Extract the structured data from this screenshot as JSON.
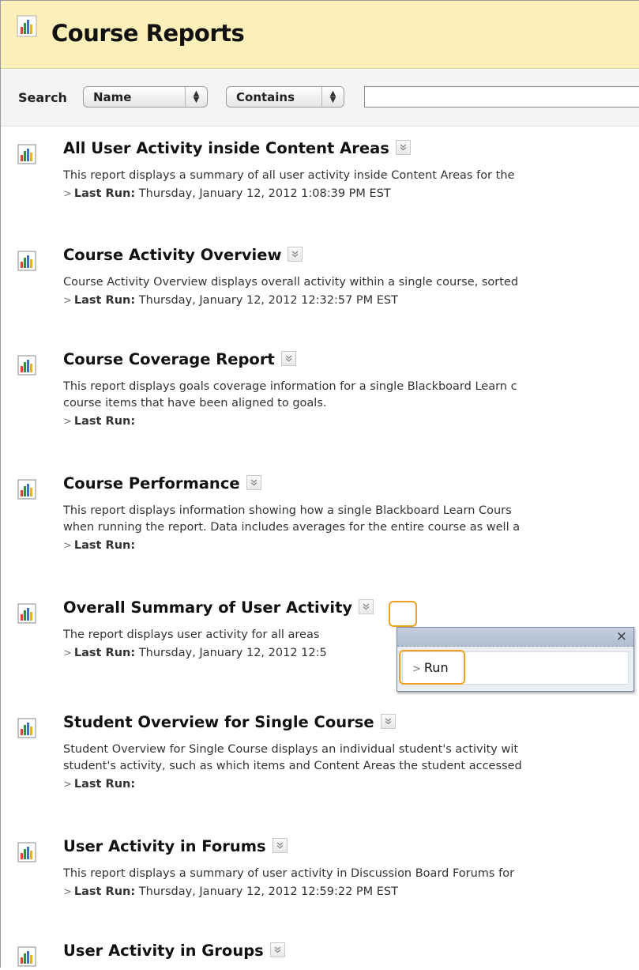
{
  "page": {
    "title": "Course Reports",
    "header_icon": "report-chart-icon",
    "header_bg": "#fcefba"
  },
  "search": {
    "label": "Search",
    "field_select": "Name",
    "operator_select": "Contains",
    "input_value": ""
  },
  "reports": [
    {
      "title": "All User Activity inside Content Areas",
      "desc": [
        "This report displays a summary of all user activity inside Content Areas for the"
      ],
      "last_run_label": "Last Run:",
      "last_run_value": "Thursday, January 12, 2012 1:08:39 PM EST"
    },
    {
      "title": "Course Activity Overview",
      "desc": [
        "Course Activity Overview displays overall activity within a single course, sorted"
      ],
      "last_run_label": "Last Run:",
      "last_run_value": "Thursday, January 12, 2012 12:32:57 PM EST"
    },
    {
      "title": "Course Coverage Report",
      "desc": [
        "This report displays goals coverage information for a single Blackboard Learn c",
        "course items that have been aligned to goals."
      ],
      "last_run_label": "Last Run:",
      "last_run_value": ""
    },
    {
      "title": "Course Performance",
      "desc": [
        "This report displays information showing how a single Blackboard Learn Cours",
        "when running the report. Data includes averages for the entire course as well a"
      ],
      "last_run_label": "Last Run:",
      "last_run_value": ""
    },
    {
      "title": "Overall Summary of User Activity",
      "desc": [
        "The report displays user activity for all areas"
      ],
      "last_run_label": "Last Run:",
      "last_run_value": "Thursday, January 12, 2012 12:5"
    },
    {
      "title": "Student Overview for Single Course",
      "desc": [
        "Student Overview for Single Course displays an individual student's activity wit",
        "student's activity, such as which items and Content Areas the student accessed"
      ],
      "last_run_label": "Last Run:",
      "last_run_value": ""
    },
    {
      "title": "User Activity in Forums",
      "desc": [
        "This report displays a summary of user activity in Discussion Board Forums for"
      ],
      "last_run_label": "Last Run:",
      "last_run_value": "Thursday, January 12, 2012 12:59:22 PM EST"
    },
    {
      "title": "User Activity in Groups",
      "desc": [],
      "last_run_label": "",
      "last_run_value": ""
    }
  ],
  "popup": {
    "close": "×",
    "item_label": "Run"
  },
  "icons": {
    "report": "report-chart-icon",
    "menu": "chevron-double-down-icon",
    "close": "close-icon"
  },
  "colors": {
    "highlight": "#f0a020",
    "popup_header": "#b8c3d6"
  }
}
